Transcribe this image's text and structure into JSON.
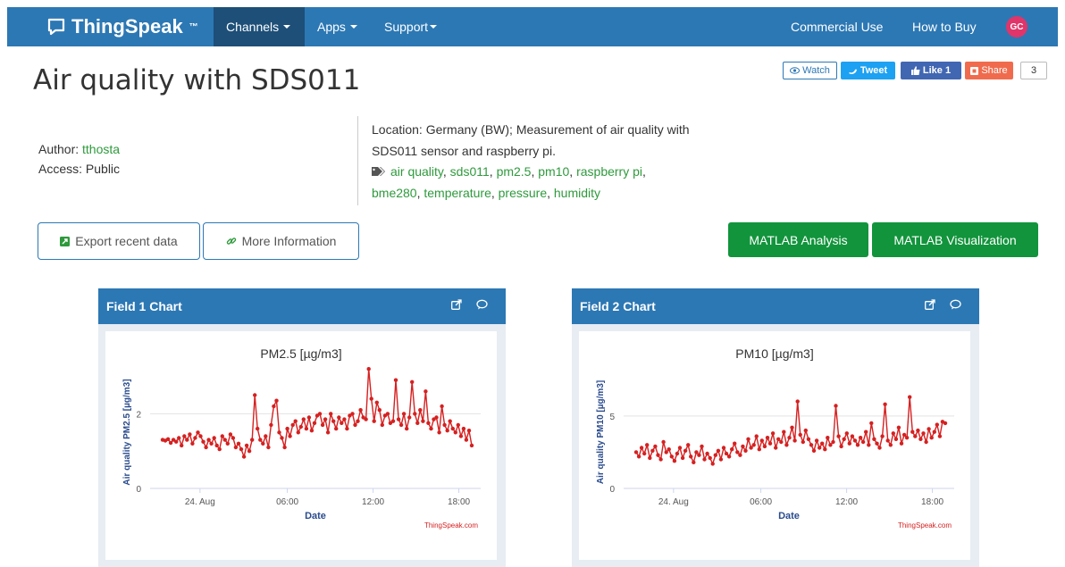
{
  "nav": {
    "brand": "ThingSpeak",
    "brand_tm": "™",
    "items": [
      {
        "label": "Channels"
      },
      {
        "label": "Apps"
      },
      {
        "label": "Support"
      }
    ],
    "right_items": [
      {
        "label": "Commercial Use"
      },
      {
        "label": "How to Buy"
      }
    ],
    "avatar_initials": "GC"
  },
  "social": {
    "watch": "Watch",
    "tweet": "Tweet",
    "like": "Like 1",
    "share": "Share",
    "count": "3"
  },
  "channel": {
    "title": "Air quality with SDS011",
    "author_label": "Author:",
    "author": "tthosta",
    "access_label": "Access:",
    "access": "Public",
    "description": "Location: Germany (BW); Measurement of air quality with SDS011 sensor and raspberry pi.",
    "tags": [
      "air quality",
      "sds011",
      "pm2.5",
      "pm10",
      "raspberry pi",
      "bme280",
      "temperature",
      "pressure",
      "humidity"
    ]
  },
  "buttons": {
    "export": "Export recent data",
    "more_info": "More Information",
    "matlab_analysis": "MATLAB Analysis",
    "matlab_visualization": "MATLAB Visualization"
  },
  "colors": {
    "navbar": "#2c78b4",
    "nav_active": "#1d4f78",
    "link_green": "#2e9a3c",
    "button_green": "#12943c",
    "series_red": "#d62020",
    "axis_label_blue": "#2a4b8d"
  },
  "icons": [
    "chat-bubble-icon",
    "caret-down-icon",
    "eye-icon",
    "twitter-icon",
    "facebook-like-icon",
    "share-icon",
    "tag-icon",
    "export-icon",
    "link-icon",
    "external-link-icon",
    "comment-icon"
  ],
  "chart_data": [
    {
      "panel_title": "Field 1 Chart",
      "type": "line",
      "title": "PM2.5 [µg/m3]",
      "xlabel": "Date",
      "ylabel": "Air quality PM2.5 [µg/m3]",
      "credit": "ThingSpeak.com",
      "ylim": [
        0,
        3.3
      ],
      "yticks": [
        0,
        2
      ],
      "xticks": [
        {
          "pos": 0.12,
          "label": "24. Aug"
        },
        {
          "pos": 0.4,
          "label": "06:00"
        },
        {
          "pos": 0.675,
          "label": "12:00"
        },
        {
          "pos": 0.95,
          "label": "18:00"
        }
      ],
      "x_range": [
        -0.04,
        1.02
      ],
      "series": [
        {
          "values": [
            1.3,
            1.28,
            1.32,
            1.22,
            1.3,
            1.25,
            1.35,
            1.15,
            1.4,
            1.3,
            1.45,
            1.2,
            1.35,
            1.5,
            1.4,
            1.25,
            1.1,
            1.3,
            1.2,
            1.35,
            1.15,
            1.05,
            1.4,
            1.3,
            1.2,
            1.45,
            1.35,
            1.1,
            1.2,
            1.05,
            0.85,
            1.15,
            1.0,
            1.3,
            2.5,
            1.6,
            1.3,
            1.2,
            1.4,
            1.1,
            1.7,
            2.2,
            2.35,
            1.5,
            1.35,
            1.1,
            1.6,
            1.4,
            1.7,
            1.8,
            1.5,
            1.65,
            1.85,
            1.6,
            1.9,
            1.55,
            1.75,
            1.95,
            2.0,
            1.7,
            1.85,
            1.5,
            2.0,
            1.8,
            1.6,
            1.9,
            1.75,
            1.85,
            1.6,
            1.95,
            2.0,
            1.7,
            1.8,
            2.1,
            1.9,
            1.85,
            3.2,
            2.4,
            1.8,
            2.3,
            2.1,
            1.7,
            1.95,
            2.0,
            1.75,
            1.8,
            2.9,
            1.85,
            1.7,
            2.0,
            1.6,
            1.9,
            2.85,
            2.0,
            1.75,
            2.1,
            1.8,
            2.6,
            1.75,
            1.6,
            1.85,
            1.9,
            1.5,
            2.2,
            1.7,
            1.55,
            1.8,
            1.6,
            1.5,
            1.7,
            1.4,
            1.6,
            1.3,
            1.55,
            1.15
          ]
        }
      ]
    },
    {
      "panel_title": "Field 2 Chart",
      "type": "line",
      "title": "PM10 [µg/m3]",
      "xlabel": "Date",
      "ylabel": "Air quality PM10 [µg/m3]",
      "credit": "ThingSpeak.com",
      "ylim": [
        0,
        8.5
      ],
      "yticks": [
        0,
        5
      ],
      "xticks": [
        {
          "pos": 0.12,
          "label": "24. Aug"
        },
        {
          "pos": 0.4,
          "label": "06:00"
        },
        {
          "pos": 0.675,
          "label": "12:00"
        },
        {
          "pos": 0.95,
          "label": "18:00"
        }
      ],
      "x_range": [
        -0.04,
        1.02
      ],
      "series": [
        {
          "values": [
            2.5,
            2.2,
            2.8,
            2.4,
            3.0,
            2.1,
            2.6,
            2.9,
            2.3,
            2.0,
            3.2,
            2.5,
            2.7,
            2.2,
            1.9,
            2.4,
            2.8,
            2.1,
            2.6,
            3.0,
            2.2,
            1.8,
            2.5,
            2.3,
            2.9,
            2.0,
            2.4,
            2.1,
            1.7,
            2.3,
            2.6,
            2.0,
            2.8,
            2.4,
            2.2,
            2.7,
            3.1,
            2.5,
            2.3,
            2.9,
            2.6,
            3.4,
            2.8,
            3.0,
            3.6,
            2.7,
            3.3,
            2.9,
            3.5,
            3.1,
            3.8,
            2.8,
            3.4,
            3.2,
            3.9,
            3.0,
            3.5,
            4.2,
            3.3,
            6.0,
            3.7,
            3.2,
            4.0,
            3.4,
            3.0,
            2.6,
            3.3,
            2.8,
            3.1,
            2.7,
            3.5,
            3.0,
            3.2,
            5.7,
            3.6,
            2.9,
            3.4,
            3.8,
            3.1,
            3.6,
            3.3,
            3.0,
            3.5,
            3.2,
            3.9,
            3.0,
            4.5,
            3.4,
            3.1,
            2.8,
            3.6,
            5.8,
            3.3,
            3.0,
            3.8,
            3.4,
            4.2,
            3.1,
            3.7,
            3.5,
            6.3,
            3.9,
            3.6,
            4.0,
            3.4,
            3.8,
            3.2,
            4.1,
            3.5,
            3.9,
            4.4,
            3.6,
            4.6,
            4.5
          ]
        }
      ]
    }
  ]
}
